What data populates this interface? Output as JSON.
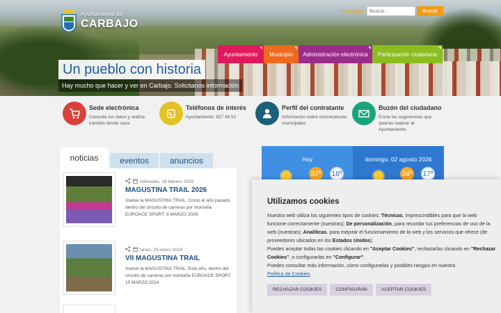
{
  "header": {
    "brand_small": "Ayuntamiento de",
    "brand_big": "CARBAJO",
    "contact": "Contacto",
    "search_placeholder": "Buscar...",
    "search_button": "Buscar"
  },
  "nav": [
    "Ayuntamiento",
    "Municipio",
    "Administración electrónica",
    "Participación ciudadana"
  ],
  "hero": {
    "slogan": "Un pueblo con historia",
    "sub": "Hay mucho que hacer y ver en Carbajo. Solicitanos información"
  },
  "quick_links": [
    {
      "title": "Sede electrónica",
      "desc": "Consulta tus datos y realiza trámites desde casa"
    },
    {
      "title": "Teléfonos de interés",
      "desc": "Ayuntamiento: 927 48 52"
    },
    {
      "title": "Perfil del contratante",
      "desc": "Información sobre convocatorias municipales"
    },
    {
      "title": "Buzón del ciudadano",
      "desc": "Envía las sugerencias que quieras realizar al Ayuntamiento"
    }
  ],
  "tabs": [
    "noticias",
    "eventos",
    "anuncios"
  ],
  "news": [
    {
      "date": "miércoles, 18 febrero 2026",
      "title": "MAGUSTINA TRAIL 2026",
      "summary": "Vuelve la MAGUSTINA TRAIL. Como el año pasado, dentro del circuito de carreras por montaña EUROACE SPORT. 8 MARZO 2026"
    },
    {
      "date": "lunes, 29 enero 2024",
      "title": "VII MAGUSTINA TRAIL",
      "summary": "Vuelve la MAGUSTINA TRAIL. Este año, dentro del circuito de carreras por montaña EUROACE SPORT. 10 MARZO 2024"
    }
  ],
  "weather": {
    "today": {
      "label": "Hoy",
      "max": "37º",
      "min": "18º"
    },
    "next": {
      "label": "domingo, 02 agosto 2026",
      "max": "34º",
      "min": "17º"
    }
  },
  "cookies": {
    "title": "Utilizamos cookies",
    "p1_a": "Nuestra web utiliza los siguientes tipos de cookies: ",
    "b1": "Técnicas",
    "p1_b": ", imprescindibles para que la web funcione correctamente (nuestras); ",
    "b2": "De personalización",
    "p1_c": ", para recordar tus preferencias de uso de la web (nuestras); ",
    "b3": "Analíticas",
    "p1_d": ", para mejorar el funcionamiento de la web y los servicios que ofrece (de proveedores ubicados en los ",
    "b4": "Estados Unidos",
    "p1_e": ").",
    "p2_a": "Puedes aceptar todas las cookies clicando en ",
    "b5": "\"Aceptar Cookies\"",
    "p2_b": ", rechazarlas clicando en ",
    "b6": "\"Rechazar Cookies\"",
    "p2_c": ", o configurarlas en ",
    "b7": "\"Configurar\"",
    "p2_d": ".",
    "p3": "Puedes consultar más información, cómo configurarlas y posibles riesgos en nuestra",
    "link": "Política de Cookies",
    "p3_end": ".",
    "btn_reject": "RECHAZAR COOKIES",
    "btn_config": "CONFIGURAR",
    "btn_accept": "ACEPTAR COOKIES"
  }
}
